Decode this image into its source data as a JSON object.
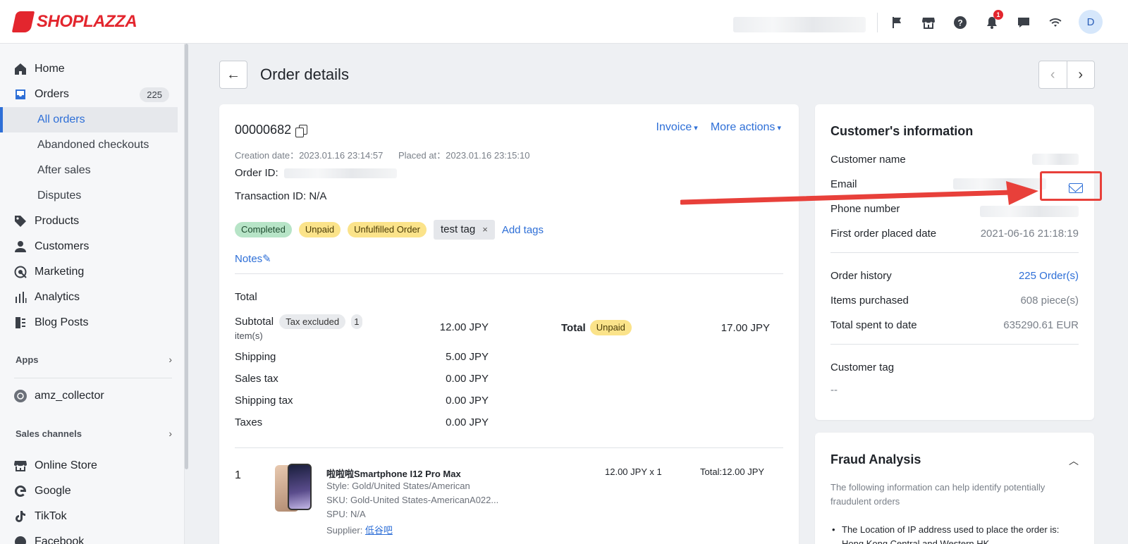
{
  "brand": {
    "name": "SHOPLAZZA"
  },
  "topbar": {
    "notification_count": "1",
    "avatar_initial": "D",
    "icons": [
      "flag-icon",
      "store-icon",
      "help-icon",
      "bell-icon",
      "chat-icon",
      "wifi-icon"
    ]
  },
  "sidebar": {
    "items": [
      {
        "label": "Home",
        "icon": "home-icon"
      },
      {
        "label": "Orders",
        "icon": "inbox-icon",
        "count": "225"
      },
      {
        "label": "Products",
        "icon": "tag-icon"
      },
      {
        "label": "Customers",
        "icon": "person-icon"
      },
      {
        "label": "Marketing",
        "icon": "megaphone-icon"
      },
      {
        "label": "Analytics",
        "icon": "bar-chart-icon"
      },
      {
        "label": "Blog Posts",
        "icon": "blog-icon"
      }
    ],
    "order_subitems": [
      "All orders",
      "Abandoned checkouts",
      "After sales",
      "Disputes"
    ],
    "apps_header": "Apps",
    "apps": [
      {
        "label": "amz_collector",
        "icon": "app-icon"
      }
    ],
    "sales_channels_header": "Sales channels",
    "channels": [
      {
        "label": "Online Store",
        "icon": "store-icon"
      },
      {
        "label": "Google",
        "icon": "google-icon"
      },
      {
        "label": "TikTok",
        "icon": "tiktok-icon"
      },
      {
        "label": "Facebook",
        "icon": "facebook-icon"
      }
    ]
  },
  "page": {
    "title": "Order details",
    "back_arrow": "←",
    "prev_arrow": "‹",
    "next_arrow": "›"
  },
  "order": {
    "number": "00000682",
    "invoice_label": "Invoice",
    "more_actions_label": "More actions",
    "creation_label": "Creation date：",
    "creation_date": "2023.01.16 23:14:57",
    "placed_label": "Placed at：",
    "placed_date": "2023.01.16 23:15:10",
    "order_id_label": "Order ID:",
    "transaction_label": "Transaction ID: N/A",
    "tags": {
      "status_completed": "Completed",
      "status_unpaid": "Unpaid",
      "status_unfulfilled": "Unfulfilled Order",
      "custom_tag": "test tag",
      "remove_tag": "×",
      "add_tags": "Add tags"
    },
    "notes_label": "Notes✎",
    "total_heading": "Total",
    "summary": {
      "subtotal_label": "Subtotal",
      "tax_excluded": "Tax excluded",
      "items_count": "1",
      "items_unit": "item(s)",
      "subtotal_value": "12.00 JPY",
      "shipping_label": "Shipping",
      "shipping_value": "5.00 JPY",
      "sales_tax_label": "Sales tax",
      "sales_tax_value": "0.00 JPY",
      "shipping_tax_label": "Shipping tax",
      "shipping_tax_value": "0.00 JPY",
      "taxes_label": "Taxes",
      "taxes_value": "0.00 JPY",
      "total_label": "Total",
      "total_status": "Unpaid",
      "total_value": "17.00 JPY"
    },
    "line_item": {
      "index": "1",
      "title": "啦啦啦Smartphone I12 Pro Max",
      "style": "Style: Gold/United States/American",
      "sku": "SKU: Gold-United States-AmericanA022...",
      "spu": "SPU: N/A",
      "supplier_label": "Supplier: ",
      "supplier_name": "低谷吧",
      "price_qty": "12.00 JPY x 1",
      "total": "Total:12.00 JPY"
    }
  },
  "customer": {
    "title": "Customer's information",
    "name_label": "Customer name",
    "email_label": "Email",
    "phone_label": "Phone number",
    "first_order_label": "First order placed date",
    "first_order_value": "2021-06-16 21:18:19",
    "order_history_label": "Order history",
    "order_history_value": "225 Order(s)",
    "items_purchased_label": "Items purchased",
    "items_purchased_value": "608 piece(s)",
    "total_spent_label": "Total spent to date",
    "total_spent_value": "635290.61 EUR",
    "tag_label": "Customer tag",
    "tag_value": "--"
  },
  "fraud": {
    "title": "Fraud Analysis",
    "description": "The following information can help identify potentially fraudulent orders",
    "bullet": "The Location of IP address used to place the order is: Hong Kong Central and Western HK"
  },
  "colors": {
    "accent": "#2e6fd7",
    "brand": "#e3262e",
    "annotation": "#e8403a"
  }
}
